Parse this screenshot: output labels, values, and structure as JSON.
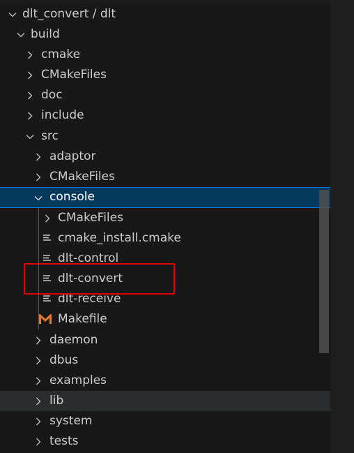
{
  "tree": {
    "rows": [
      {
        "label": "dlt_convert / dlt",
        "expanded": true,
        "type": "folder"
      },
      {
        "label": "build",
        "expanded": true,
        "type": "folder"
      },
      {
        "label": "cmake",
        "expanded": false,
        "type": "folder"
      },
      {
        "label": "CMakeFiles",
        "expanded": false,
        "type": "folder"
      },
      {
        "label": "doc",
        "expanded": false,
        "type": "folder"
      },
      {
        "label": "include",
        "expanded": false,
        "type": "folder"
      },
      {
        "label": "src",
        "expanded": true,
        "type": "folder"
      },
      {
        "label": "adaptor",
        "expanded": false,
        "type": "folder"
      },
      {
        "label": "CMakeFiles",
        "expanded": false,
        "type": "folder"
      },
      {
        "label": "console",
        "expanded": true,
        "type": "folder",
        "selected": true
      },
      {
        "label": "CMakeFiles",
        "expanded": false,
        "type": "folder"
      },
      {
        "label": "cmake_install.cmake",
        "type": "file",
        "icon": "lines-file-icon"
      },
      {
        "label": "dlt-control",
        "type": "file",
        "icon": "lines-file-icon"
      },
      {
        "label": "dlt-convert",
        "type": "file",
        "icon": "lines-file-icon",
        "highlighted": true
      },
      {
        "label": "dlt-receive",
        "type": "file",
        "icon": "lines-file-icon"
      },
      {
        "label": "Makefile",
        "type": "file",
        "icon": "makefile-m-icon"
      },
      {
        "label": "daemon",
        "expanded": false,
        "type": "folder"
      },
      {
        "label": "dbus",
        "expanded": false,
        "type": "folder"
      },
      {
        "label": "examples",
        "expanded": false,
        "type": "folder"
      },
      {
        "label": "lib",
        "expanded": false,
        "type": "folder",
        "hover": true
      },
      {
        "label": "system",
        "expanded": false,
        "type": "folder"
      },
      {
        "label": "tests",
        "expanded": false,
        "type": "folder"
      }
    ]
  },
  "colors": {
    "selection_bg": "#04395e",
    "selection_border": "#0078d4",
    "highlight_box": "#e30000",
    "makefile_icon": "#e37933"
  }
}
